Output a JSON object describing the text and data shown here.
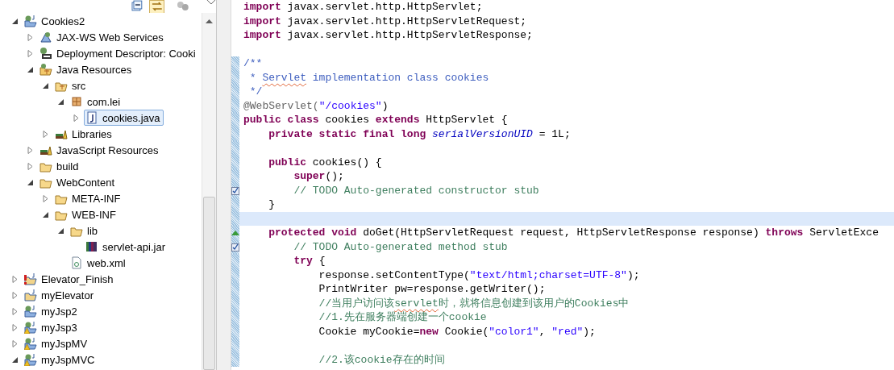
{
  "explorer": {
    "tree": [
      {
        "label": "Cookies2",
        "kind": "web-project",
        "expanded": true,
        "selected": false,
        "children": [
          {
            "label": "JAX-WS Web Services",
            "kind": "service",
            "expanded": false,
            "selected": false
          },
          {
            "label": "Deployment Descriptor: Cooki",
            "kind": "descriptor",
            "expanded": false,
            "selected": false
          },
          {
            "label": "Java Resources",
            "kind": "java-resources",
            "expanded": true,
            "selected": false,
            "children": [
              {
                "label": "src",
                "kind": "source-folder",
                "expanded": true,
                "selected": false,
                "children": [
                  {
                    "label": "com.lei",
                    "kind": "package",
                    "expanded": true,
                    "selected": false,
                    "children": [
                      {
                        "label": "cookies.java",
                        "kind": "java-file",
                        "expanded": false,
                        "selected": true
                      }
                    ]
                  }
                ]
              },
              {
                "label": "Libraries",
                "kind": "libraries",
                "expanded": false,
                "selected": false
              }
            ]
          },
          {
            "label": "JavaScript Resources",
            "kind": "libraries",
            "expanded": false,
            "selected": false
          },
          {
            "label": "build",
            "kind": "folder",
            "expanded": false,
            "selected": false
          },
          {
            "label": "WebContent",
            "kind": "folder",
            "expanded": true,
            "selected": false,
            "children": [
              {
                "label": "META-INF",
                "kind": "folder",
                "expanded": false,
                "selected": false
              },
              {
                "label": "WEB-INF",
                "kind": "folder",
                "expanded": true,
                "selected": false,
                "children": [
                  {
                    "label": "lib",
                    "kind": "folder",
                    "expanded": true,
                    "selected": false,
                    "children": [
                      {
                        "label": "servlet-api.jar",
                        "kind": "jar",
                        "selected": false
                      }
                    ]
                  },
                  {
                    "label": "web.xml",
                    "kind": "xml-file",
                    "selected": false
                  }
                ]
              }
            ]
          }
        ]
      },
      {
        "label": "Elevator_Finish",
        "kind": "project-error",
        "expanded": false,
        "selected": false
      },
      {
        "label": "myElevator",
        "kind": "project",
        "expanded": false,
        "selected": false
      },
      {
        "label": "myJsp2",
        "kind": "web-project",
        "expanded": false,
        "selected": false
      },
      {
        "label": "myJsp3",
        "kind": "web-project-warning",
        "expanded": false,
        "selected": false
      },
      {
        "label": "myJspMV",
        "kind": "web-project-warning",
        "expanded": false,
        "selected": false
      },
      {
        "label": "myJspMVC",
        "kind": "web-project-warning",
        "expanded": true,
        "selected": false
      }
    ]
  },
  "editor": {
    "lines": [
      {
        "kind": "code",
        "changed": false,
        "highlighted": false,
        "segments": [
          {
            "kind": "keyword",
            "text": "import"
          },
          {
            "kind": "plain",
            "text": " javax.servlet.http.HttpServlet;"
          }
        ]
      },
      {
        "kind": "code",
        "changed": false,
        "highlighted": false,
        "segments": [
          {
            "kind": "keyword",
            "text": "import"
          },
          {
            "kind": "plain",
            "text": " javax.servlet.http.HttpServletRequest;"
          }
        ]
      },
      {
        "kind": "code",
        "changed": false,
        "highlighted": false,
        "segments": [
          {
            "kind": "keyword",
            "text": "import"
          },
          {
            "kind": "plain",
            "text": " javax.servlet.http.HttpServletResponse;"
          }
        ]
      },
      {
        "kind": "code",
        "changed": false,
        "highlighted": false
      },
      {
        "kind": "code",
        "changed": true,
        "highlighted": false,
        "segments": [
          {
            "kind": "javadoc",
            "text": "/**"
          }
        ]
      },
      {
        "kind": "code",
        "changed": true,
        "highlighted": false,
        "segments": [
          {
            "kind": "javadoc",
            "text": " * "
          },
          {
            "kind": "javadoc",
            "text": "Servlet",
            "misspelled": true
          },
          {
            "kind": "javadoc",
            "text": " implementation class cookies"
          }
        ]
      },
      {
        "kind": "code",
        "changed": true,
        "highlighted": false,
        "segments": [
          {
            "kind": "javadoc",
            "text": " */"
          }
        ]
      },
      {
        "kind": "code",
        "changed": true,
        "highlighted": false,
        "segments": [
          {
            "kind": "annotation",
            "text": "@WebServlet("
          },
          {
            "kind": "string",
            "text": "\"/cookies\""
          },
          {
            "kind": "plain",
            "text": ")"
          }
        ]
      },
      {
        "kind": "code",
        "changed": true,
        "highlighted": false,
        "segments": [
          {
            "kind": "keyword",
            "text": "public class"
          },
          {
            "kind": "plain",
            "text": " cookies "
          },
          {
            "kind": "keyword",
            "text": "extends"
          },
          {
            "kind": "plain",
            "text": " HttpServlet {"
          }
        ]
      },
      {
        "kind": "code",
        "changed": true,
        "highlighted": false,
        "segments": [
          {
            "kind": "keyword",
            "text": "    private static final long "
          },
          {
            "kind": "field",
            "text": "serialVersionUID"
          },
          {
            "kind": "plain",
            "text": " = 1L;"
          }
        ]
      },
      {
        "kind": "code",
        "changed": true,
        "highlighted": false
      },
      {
        "kind": "code",
        "changed": true,
        "highlighted": false,
        "segments": [
          {
            "kind": "keyword",
            "text": "    public"
          },
          {
            "kind": "plain",
            "text": " cookies() {"
          }
        ]
      },
      {
        "kind": "code",
        "changed": true,
        "highlighted": false,
        "segments": [
          {
            "kind": "keyword",
            "text": "        super"
          },
          {
            "kind": "plain",
            "text": "();"
          }
        ]
      },
      {
        "kind": "task",
        "changed": true,
        "highlighted": false,
        "segments": [
          {
            "kind": "comment",
            "text": "        // TODO Auto-generated constructor stub"
          }
        ]
      },
      {
        "kind": "code",
        "changed": true,
        "highlighted": false,
        "segments": [
          {
            "kind": "plain",
            "text": "    }"
          }
        ]
      },
      {
        "kind": "code",
        "changed": true,
        "highlighted": true
      },
      {
        "kind": "override",
        "changed": true,
        "highlighted": false,
        "segments": [
          {
            "kind": "keyword",
            "text": "    protected void"
          },
          {
            "kind": "plain",
            "text": " doGet(HttpServletRequest request, HttpServletResponse response) "
          },
          {
            "kind": "keyword",
            "text": "throws"
          },
          {
            "kind": "plain",
            "text": " ServletExce"
          }
        ]
      },
      {
        "kind": "task",
        "changed": true,
        "highlighted": false,
        "segments": [
          {
            "kind": "comment",
            "text": "        // TODO Auto-generated method stub"
          }
        ]
      },
      {
        "kind": "code",
        "changed": true,
        "highlighted": false,
        "segments": [
          {
            "kind": "keyword",
            "text": "        try"
          },
          {
            "kind": "plain",
            "text": " {"
          }
        ]
      },
      {
        "kind": "code",
        "changed": true,
        "highlighted": false,
        "segments": [
          {
            "kind": "plain",
            "text": "            response.setContentType("
          },
          {
            "kind": "string",
            "text": "\"text/html;charset=UTF-8\""
          },
          {
            "kind": "plain",
            "text": ");"
          }
        ]
      },
      {
        "kind": "code",
        "changed": true,
        "highlighted": false,
        "segments": [
          {
            "kind": "plain",
            "text": "            PrintWriter pw=response.getWriter();"
          }
        ]
      },
      {
        "kind": "code",
        "changed": true,
        "highlighted": false,
        "segments": [
          {
            "kind": "comment",
            "text": "            //当用户访问该"
          },
          {
            "kind": "comment",
            "text": "servlet",
            "misspelled": true
          },
          {
            "kind": "comment",
            "text": "时，就将信息创建到该用户的Cookies中"
          }
        ]
      },
      {
        "kind": "code",
        "changed": true,
        "highlighted": false,
        "segments": [
          {
            "kind": "comment",
            "text": "            //1.先在服务器端创建一个cookie"
          }
        ]
      },
      {
        "kind": "code",
        "changed": true,
        "highlighted": false,
        "segments": [
          {
            "kind": "plain",
            "text": "            Cookie myCookie="
          },
          {
            "kind": "keyword",
            "text": "new"
          },
          {
            "kind": "plain",
            "text": " Cookie("
          },
          {
            "kind": "string",
            "text": "\"color1\""
          },
          {
            "kind": "plain",
            "text": ", "
          },
          {
            "kind": "string",
            "text": "\"red\""
          },
          {
            "kind": "plain",
            "text": ");"
          }
        ]
      },
      {
        "kind": "code",
        "changed": true,
        "highlighted": false
      },
      {
        "kind": "code",
        "changed": true,
        "highlighted": false,
        "segments": [
          {
            "kind": "comment",
            "text": "            //2.该cookie存在的时间"
          }
        ]
      }
    ]
  }
}
